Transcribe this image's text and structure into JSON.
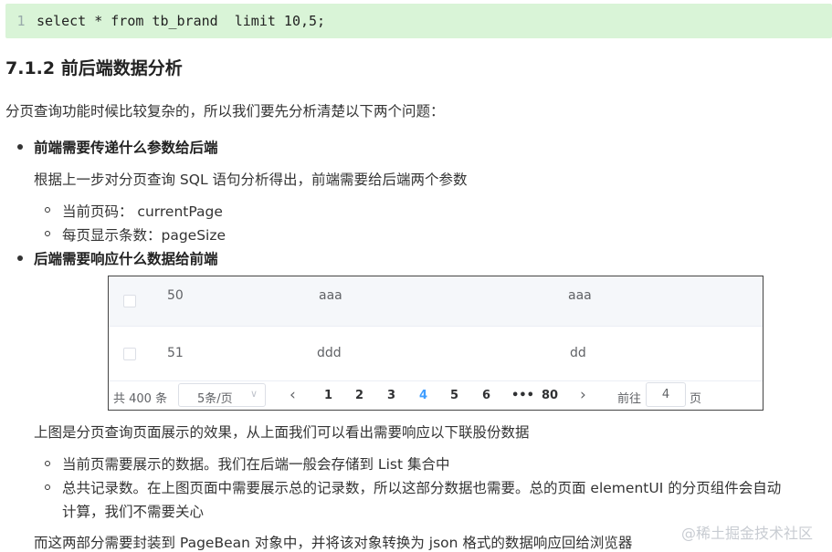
{
  "code": {
    "line_number": "1",
    "text": "select * from tb_brand  limit 10,5;"
  },
  "heading": "7.1.2 前后端数据分析",
  "intro": "分页查询功能时候比较复杂的，所以我们要先分析清楚以下两个问题：",
  "section1": {
    "title": "前端需要传递什么参数给后端",
    "desc": "根据上一步对分页查询 SQL 语句分析得出，前端需要给后端两个参数",
    "items": [
      "当前页码： currentPage",
      "每页显示条数：pageSize"
    ]
  },
  "section2": {
    "title": "后端需要响应什么数据给前端",
    "table": {
      "rows": [
        {
          "id": "50",
          "col2": "aaa",
          "col3": "aaa"
        },
        {
          "id": "51",
          "col2": "ddd",
          "col3": "dd"
        }
      ],
      "pager": {
        "total": "共 400 条",
        "page_size": "5条/页",
        "prev": "‹",
        "pages": [
          "1",
          "2",
          "3",
          "4",
          "5",
          "6",
          "•••",
          "80"
        ],
        "active_page": "4",
        "next": "›",
        "goto_label": "前往",
        "goto_value": "4",
        "goto_suffix": "页"
      }
    },
    "desc": "上图是分页查询页面展示的效果，从上面我们可以看出需要响应以下联股份数据",
    "items": [
      "当前页需要展示的数据。我们在后端一般会存储到 List 集合中",
      "总共记录数。在上图页面中需要展示总的记录数，所以这部分数据也需要。总的页面 elementUI 的分页组件会自动",
      "计算，我们不需要关心"
    ],
    "footer": "而这两部分需要封装到 PageBean 对象中，并将该对象转换为 json 格式的数据响应回给浏览器"
  },
  "watermark": "@稀土掘金技术社区"
}
